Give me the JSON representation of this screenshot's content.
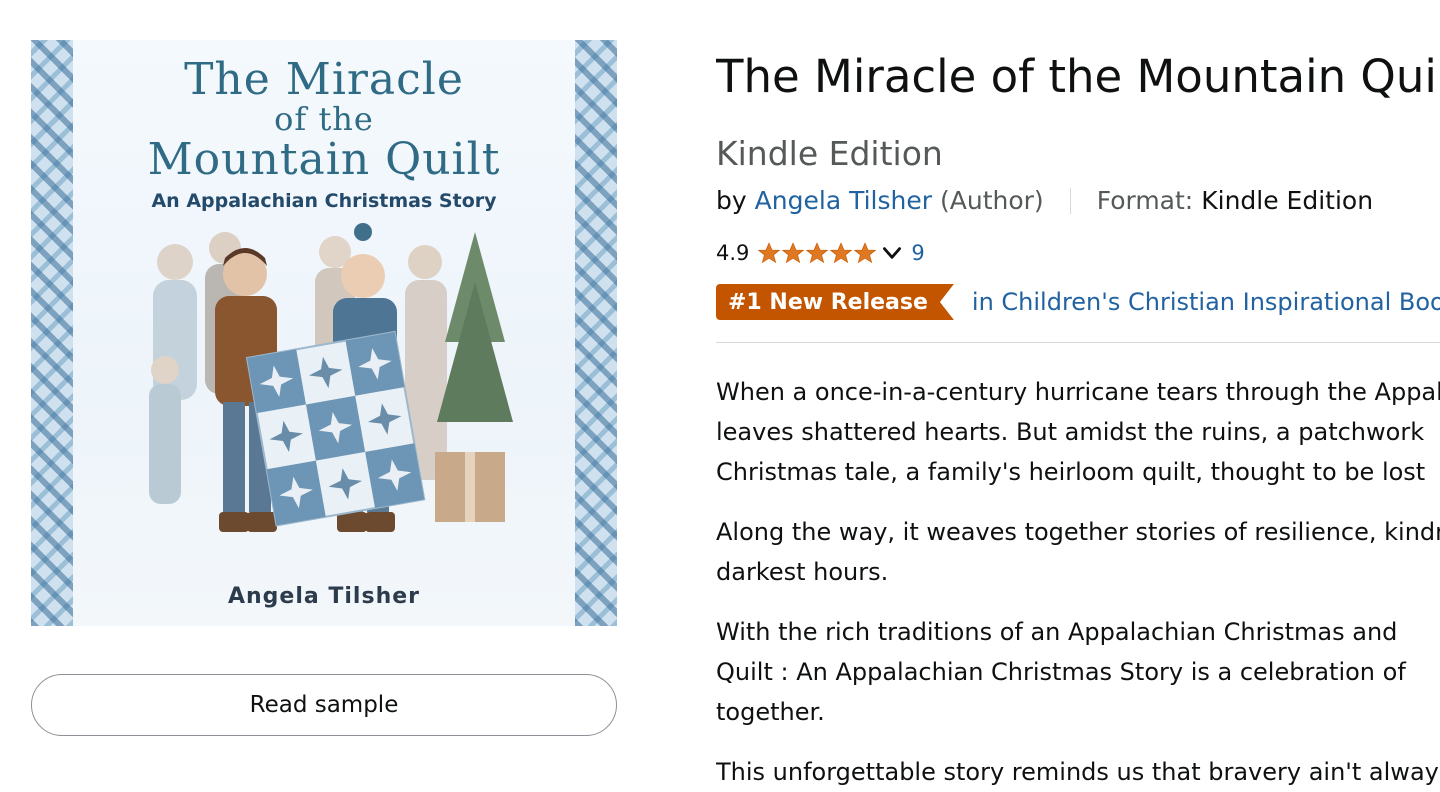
{
  "cover": {
    "title_line1": "The Miracle",
    "title_line2": "of the",
    "title_line3": "Mountain Quilt",
    "subtitle": "An Appalachian Christmas Story",
    "author": "Angela Tilsher"
  },
  "actions": {
    "read_sample_label": "Read sample"
  },
  "product": {
    "title": "The Miracle of the Mountain Quilt",
    "edition": "Kindle Edition",
    "by_label": "by",
    "author_name": "Angela Tilsher",
    "author_role": "(Author)",
    "format_label": "Format:",
    "format_value": "Kindle Edition"
  },
  "rating": {
    "value": "4.9",
    "stars": 5,
    "count": "9",
    "star_color": "#de7921"
  },
  "badge": {
    "label": "#1 New Release",
    "category": "in Children's Christian Inspirational Books",
    "color": "#c45500"
  },
  "description": {
    "p1_l1": "When a once-in-a-century hurricane tears through the Appalachian",
    "p1_l2": "leaves shattered hearts. But amidst the ruins, a patchwork",
    "p1_l3": "Christmas tale, a family's heirloom quilt, thought to be lost",
    "p2_l1": "Along the way, it weaves together stories of resilience, kindness",
    "p2_l2": "darkest hours.",
    "p3_l1": "With the rich traditions of an Appalachian Christmas and",
    "p3_l2": "Quilt : An Appalachian Christmas Story is a celebration of",
    "p3_l3": "together.",
    "p4_l1": "This unforgettable story reminds us that bravery ain't always"
  },
  "icons": {
    "star": "star-icon",
    "chevron": "chevron-down-icon"
  },
  "colors": {
    "link": "#2162a1",
    "muted": "#565959",
    "text": "#0f1111"
  }
}
